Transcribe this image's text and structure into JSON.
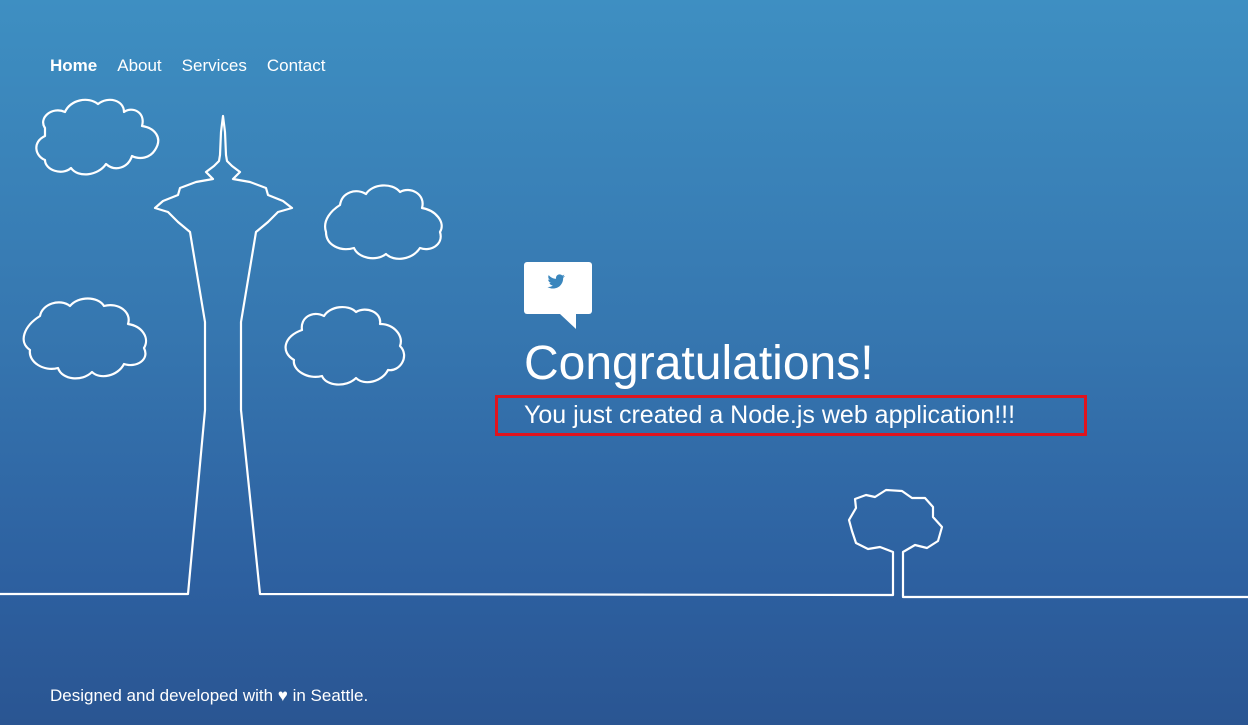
{
  "nav": {
    "items": [
      {
        "label": "Home",
        "active": true
      },
      {
        "label": "About",
        "active": false
      },
      {
        "label": "Services",
        "active": false
      },
      {
        "label": "Contact",
        "active": false
      }
    ]
  },
  "hero": {
    "icon": "twitter-bird-icon",
    "title": "Congratulations!",
    "subtitle": "You just created a Node.js web application!!!"
  },
  "footer": {
    "text": "Designed and developed with ♥ in Seattle."
  },
  "colors": {
    "background_top": "#3e8fc2",
    "background_bottom": "#2a5592",
    "text": "#ffffff",
    "highlight_border": "#e0141e"
  }
}
